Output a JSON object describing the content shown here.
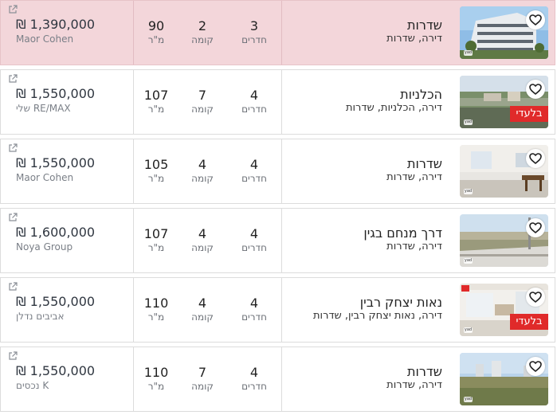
{
  "colors": {
    "highlight_row": "#f3d6da",
    "exclusive_badge": "#e02a2a",
    "text_primary": "#222222",
    "text_secondary": "#7a7f87"
  },
  "icons": {
    "favorite": "heart-outline-icon",
    "open_new": "external-link-icon"
  },
  "listings": [
    {
      "street": "שדרות",
      "desc": "דירה, שדרות",
      "rooms": "3",
      "rooms_label": "חדרים",
      "floor": "2",
      "floor_label": "קומה",
      "sqm": "90",
      "sqm_label": "מ\"ר",
      "price": "₪ 1,390,000",
      "agency": "Maor Cohen",
      "exclusive": "",
      "highlight": true
    },
    {
      "street": "הכלניות",
      "desc": "דירה, הכלניות, שדרות",
      "rooms": "4",
      "rooms_label": "חדרים",
      "floor": "7",
      "floor_label": "קומה",
      "sqm": "107",
      "sqm_label": "מ\"ר",
      "price": "₪ 1,550,000",
      "agency": "RE/MAX שלי",
      "exclusive": "בלעדי",
      "highlight": false
    },
    {
      "street": "שדרות",
      "desc": "דירה, שדרות",
      "rooms": "4",
      "rooms_label": "חדרים",
      "floor": "4",
      "floor_label": "קומה",
      "sqm": "105",
      "sqm_label": "מ\"ר",
      "price": "₪ 1,550,000",
      "agency": "Maor Cohen",
      "exclusive": "",
      "highlight": false
    },
    {
      "street": "דרך מנחם בגין",
      "desc": "דירה, שדרות",
      "rooms": "4",
      "rooms_label": "חדרים",
      "floor": "4",
      "floor_label": "קומה",
      "sqm": "107",
      "sqm_label": "מ\"ר",
      "price": "₪ 1,600,000",
      "agency": "Noya Group",
      "exclusive": "",
      "highlight": false
    },
    {
      "street": "נאות יצחק רבין",
      "desc": "דירה, נאות יצחק רבין, שדרות",
      "rooms": "4",
      "rooms_label": "חדרים",
      "floor": "4",
      "floor_label": "קומה",
      "sqm": "110",
      "sqm_label": "מ\"ר",
      "price": "₪ 1,550,000",
      "agency": "אביבים נדלן",
      "exclusive": "בלעדי",
      "highlight": false
    },
    {
      "street": "שדרות",
      "desc": "דירה, שדרות",
      "rooms": "4",
      "rooms_label": "חדרים",
      "floor": "7",
      "floor_label": "קומה",
      "sqm": "110",
      "sqm_label": "מ\"ר",
      "price": "₪ 1,550,000",
      "agency": "K נכסים",
      "exclusive": "",
      "highlight": false
    }
  ]
}
